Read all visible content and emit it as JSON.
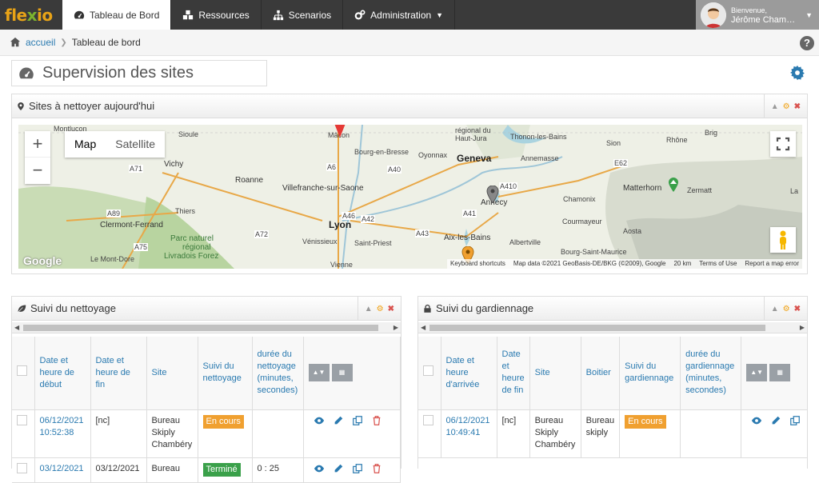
{
  "app": {
    "logo_a": "fle",
    "logo_b": "x",
    "logo_c": "io"
  },
  "nav": [
    {
      "label": "Tableau de Bord",
      "icon": "dashboard-icon"
    },
    {
      "label": "Ressources",
      "icon": "cubes-icon"
    },
    {
      "label": "Scenarios",
      "icon": "sitemap-icon"
    },
    {
      "label": "Administration",
      "icon": "cogs-icon"
    }
  ],
  "user": {
    "welcome": "Bienvenue,",
    "name": "Jérôme Cham…"
  },
  "breadcrumb": {
    "home": "accueil",
    "current": "Tableau de bord"
  },
  "page": {
    "title": "Supervision des sites"
  },
  "map_panel": {
    "title": "Sites à nettoyer aujourd'hui",
    "map_types": [
      "Map",
      "Satellite"
    ],
    "attribution": [
      "Keyboard shortcuts",
      "Map data ©2021 GeoBasis-DE/BKG (©2009), Google",
      "20 km",
      "Terms of Use",
      "Report a map error"
    ],
    "google": "Google",
    "labels": {
      "montlucon": "Montluçon",
      "sioule": "Sioule",
      "vichy": "Vichy",
      "roanne": "Roanne",
      "thiers": "Thiers",
      "clermont": "Clermont-Ferrand",
      "parc": "Parc naturel",
      "regional": "régional",
      "livradois": "Livradois Forez",
      "montdore": "Le Mont-Dore",
      "macon": "Mâcon",
      "bourg": "Bourg-en-Bresse",
      "villefranche": "Villefranche-sur-Saone",
      "lyon": "Lyon",
      "venissieux": "Vénissieux",
      "stpriest": "Saint-Priest",
      "vienne": "Vienne",
      "oyonnax": "Oyonnax",
      "hautjura": "régional du Haut-Jura",
      "geneva": "Geneva",
      "annemasse": "Annemasse",
      "thonon": "Thonon-les-Bains",
      "annecy": "Annecy",
      "aix": "Aix-les-Bains",
      "albertville": "Albertville",
      "chamonix": "Chamonix",
      "courmayeur": "Courmayeur",
      "aosta": "Aosta",
      "matterhorn": "Matterhorn",
      "zermatt": "Zermatt",
      "brig": "Brig",
      "rhone": "Rhône",
      "bourgstmaurice": "Bourg-Saint-Maurice",
      "sion": "Sion",
      "la": "La",
      "a71": "A71",
      "a89": "A89",
      "a72": "A72",
      "a75": "A75",
      "a6": "A6",
      "a40": "A40",
      "a46": "A46",
      "a42": "A42",
      "a43": "A43",
      "a410": "A410",
      "e62": "E62",
      "a41": "A41"
    }
  },
  "cleaning_panel": {
    "title": "Suivi du nettoyage",
    "headers": [
      "Date et heure de début",
      "Date et heure de fin",
      "Site",
      "Suivi du nettoyage",
      "durée du nettoyage (minutes, secondes)"
    ],
    "rows": [
      {
        "start": "06/12/2021 10:52:38",
        "end": "[nc]",
        "site": "Bureau Skiply Chambéry",
        "status": "En cours",
        "status_color": "#f0a030",
        "duration": ""
      },
      {
        "start": "03/12/2021",
        "end": "03/12/2021",
        "site": "Bureau",
        "status": "Terminé",
        "status_color": "#3aa04a",
        "duration": "0 : 25"
      }
    ]
  },
  "guard_panel": {
    "title": "Suivi du gardiennage",
    "headers": [
      "Date et heure d'arrivée",
      "Date et heure de fin",
      "Site",
      "Boitier",
      "Suivi du gardiennage",
      "durée du gardiennage (minutes, secondes)"
    ],
    "rows": [
      {
        "start": "06/12/2021 10:49:41",
        "end": "[nc]",
        "site": "Bureau Skiply Chambéry",
        "boitier": "Bureau skiply",
        "status": "En cours",
        "status_color": "#f0a030",
        "duration": ""
      }
    ]
  }
}
